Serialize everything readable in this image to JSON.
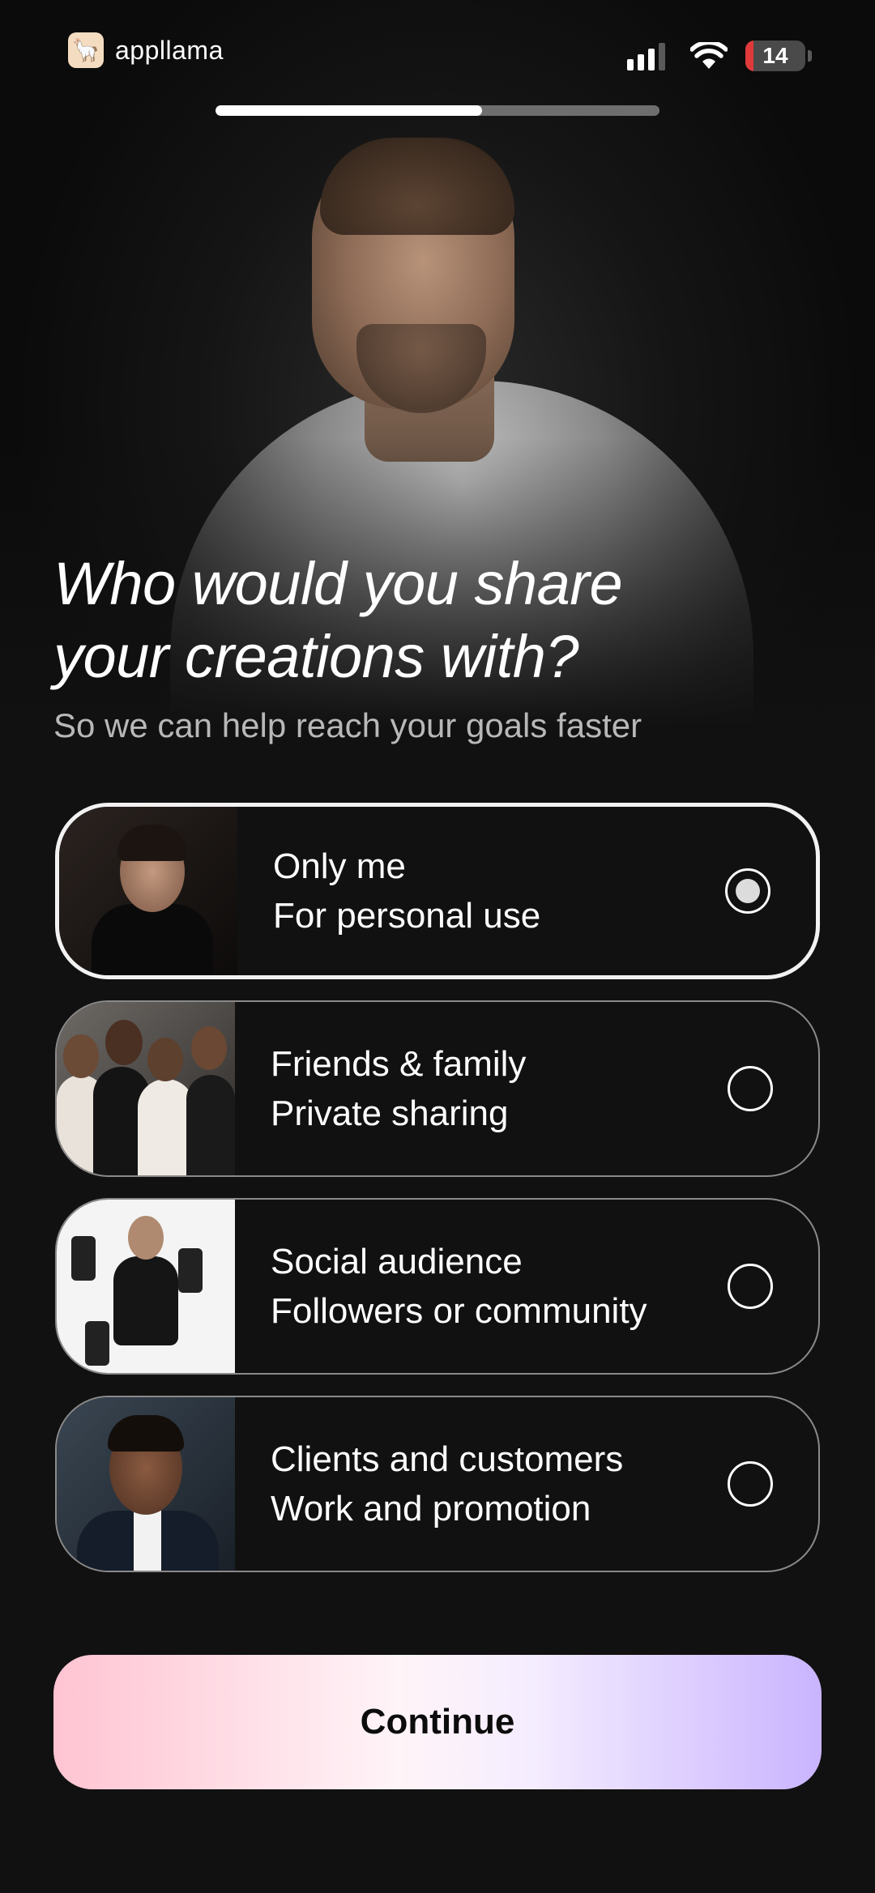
{
  "status_bar": {
    "app_name": "appllama",
    "battery_level": "14",
    "battery_color": "#e0393a"
  },
  "progress": {
    "value": 0.6
  },
  "header": {
    "title_line1": "Who would you share",
    "title_line2": "your creations with?",
    "subtitle": "So we can help reach your goals faster"
  },
  "options": [
    {
      "title": "Only me",
      "subtitle": "For personal use",
      "selected": true
    },
    {
      "title": "Friends & family",
      "subtitle": "Private sharing",
      "selected": false
    },
    {
      "title": "Social audience",
      "subtitle": "Followers or community",
      "selected": false
    },
    {
      "title": "Clients and customers",
      "subtitle": "Work and promotion",
      "selected": false
    }
  ],
  "continue_label": "Continue",
  "colors": {
    "background": "#111111",
    "accent_gradient_start": "#ffc4d2",
    "accent_gradient_end": "#c9b4ff"
  }
}
